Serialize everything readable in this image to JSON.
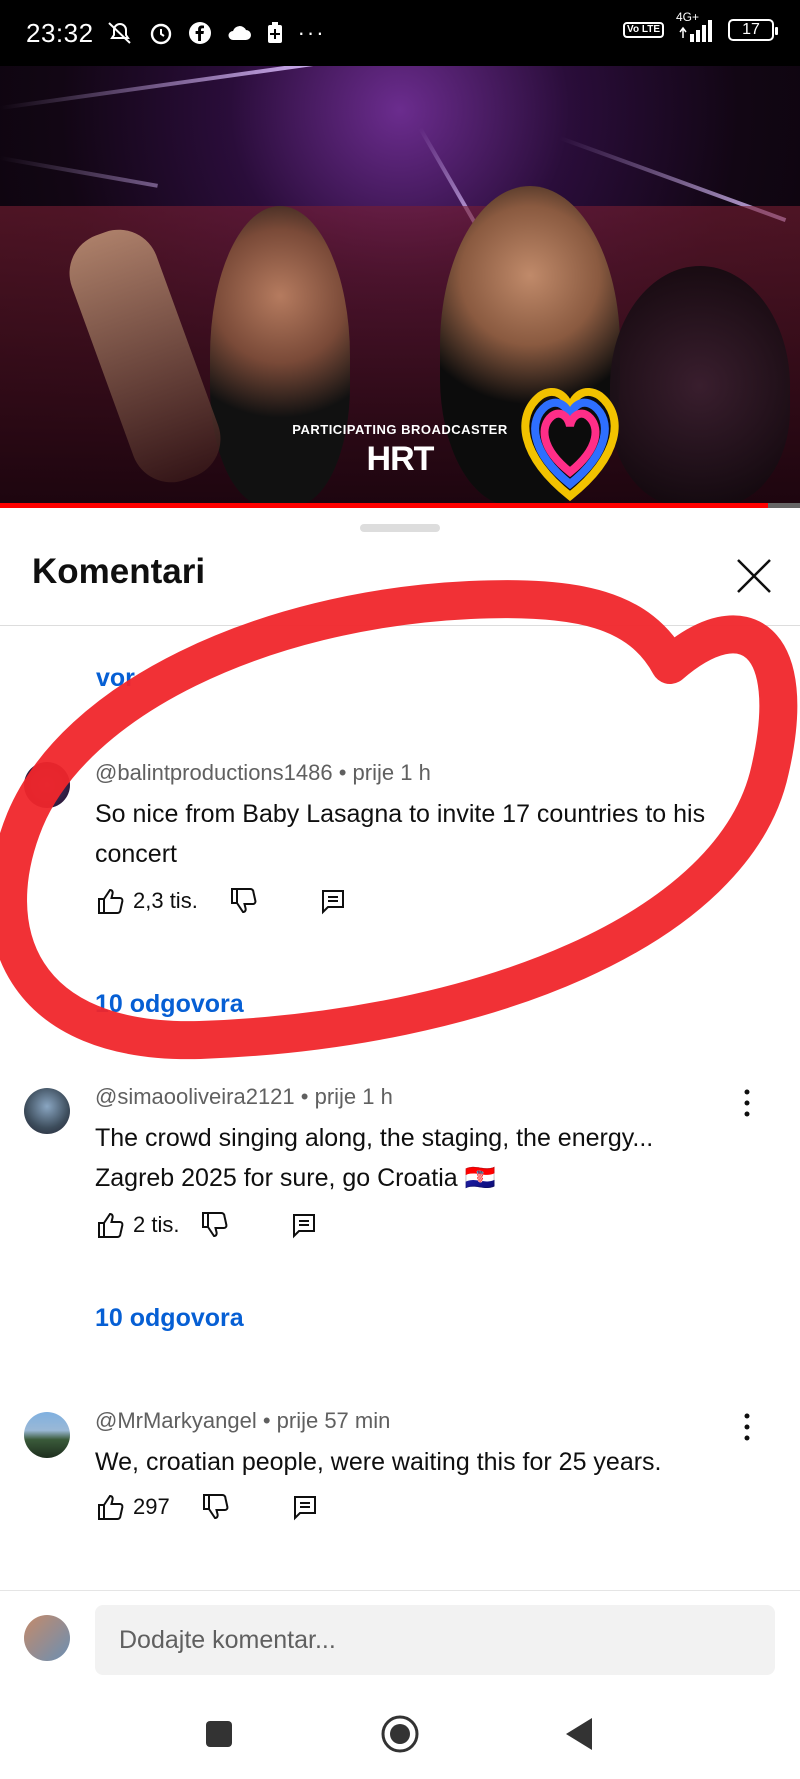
{
  "status_bar": {
    "time": "23:32",
    "network": "4G+",
    "volte": "Vo LTE",
    "battery": "17"
  },
  "video": {
    "broadcaster_caption": "PARTICIPATING BROADCASTER",
    "broadcaster_logo": "HRT",
    "progress_fraction": 0.96
  },
  "comments_panel": {
    "title": "Komentari",
    "partial_reply_text": "vor",
    "comments": [
      {
        "author": "@balintproductions1486",
        "time": "prije 1 h",
        "text": "So nice from Baby Lasagna to invite 17 countries to his concert",
        "likes": "2,3 tis.",
        "replies": "10 odgovora"
      },
      {
        "author": "@simaooliveira2121",
        "time": "prije 1 h",
        "text": "The crowd singing along, the staging, the energy... Zagreb 2025 for sure, go Croatia 🇭🇷",
        "likes": "2 tis.",
        "replies": "10 odgovora"
      },
      {
        "author": "@MrMarkyangel",
        "time": "prije 57 min",
        "text": "We, croatian people, were waiting this for 25 years.",
        "likes": "297"
      }
    ],
    "input_placeholder": "Dodajte komentar..."
  },
  "colors": {
    "link": "#065fd4",
    "annotation": "#f0262b"
  }
}
